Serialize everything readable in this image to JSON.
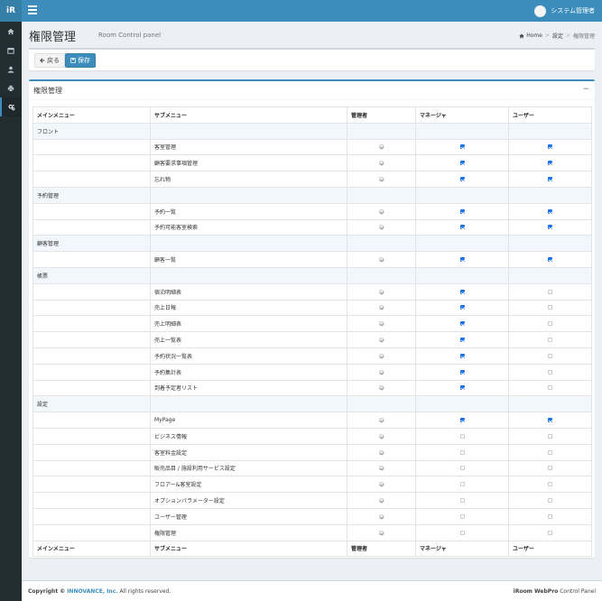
{
  "app": {
    "logo": "iR",
    "user_name": "システム管理者"
  },
  "sidebar": {
    "icons": [
      "home-icon",
      "calendar-icon",
      "user-icon",
      "printer-icon",
      "gears-icon"
    ]
  },
  "header": {
    "title": "権限管理",
    "subtitle": "Room Control panel",
    "breadcrumb": {
      "home": "Home",
      "settings": "設定",
      "current": "権限管理"
    }
  },
  "actions": {
    "back_label": "戻る",
    "save_label": "保存"
  },
  "box": {
    "title": "権限管理",
    "collapse": "−"
  },
  "table": {
    "headers": [
      "メインメニュー",
      "サブメニュー",
      "管理者",
      "マネージャ",
      "ユーザー"
    ],
    "rows": [
      {
        "main": "フロント",
        "section": true
      },
      {
        "sub": "客室管理",
        "admin": true,
        "manager": true,
        "user": true
      },
      {
        "sub": "顧客要求事項管理",
        "admin": true,
        "manager": true,
        "user": true
      },
      {
        "sub": "忘れ物",
        "admin": true,
        "manager": true,
        "user": true
      },
      {
        "main": "予約管理",
        "section": true
      },
      {
        "sub": "予約一覧",
        "admin": true,
        "manager": true,
        "user": true
      },
      {
        "sub": "予約可能客室検索",
        "admin": true,
        "manager": true,
        "user": true
      },
      {
        "main": "顧客管理",
        "section": true
      },
      {
        "sub": "顧客一覧",
        "admin": true,
        "manager": true,
        "user": true
      },
      {
        "main": "帳票",
        "section": true
      },
      {
        "sub": "宿泊明細表",
        "admin": true,
        "manager": true,
        "user": false
      },
      {
        "sub": "売上日報",
        "admin": true,
        "manager": true,
        "user": false
      },
      {
        "sub": "売上明細表",
        "admin": true,
        "manager": true,
        "user": false
      },
      {
        "sub": "売上一覧表",
        "admin": true,
        "manager": true,
        "user": false
      },
      {
        "sub": "予約状況一覧表",
        "admin": true,
        "manager": true,
        "user": false
      },
      {
        "sub": "予約集計表",
        "admin": true,
        "manager": true,
        "user": false
      },
      {
        "sub": "到着予定者リスト",
        "admin": true,
        "manager": true,
        "user": false
      },
      {
        "main": "設定",
        "section": true
      },
      {
        "sub": "MyPage",
        "admin": true,
        "manager": true,
        "user": true
      },
      {
        "sub": "ビジネス情報",
        "admin": true,
        "manager": false,
        "user": false
      },
      {
        "sub": "客室料金設定",
        "admin": true,
        "manager": false,
        "user": false
      },
      {
        "sub": "販売品目 / 施設利用サービス設定",
        "admin": true,
        "manager": false,
        "user": false
      },
      {
        "sub": "フロアー&客室設定",
        "admin": true,
        "manager": false,
        "user": false
      },
      {
        "sub": "オプションパラメーター設定",
        "admin": true,
        "manager": false,
        "user": false
      },
      {
        "sub": "ユーザー管理",
        "admin": true,
        "manager": false,
        "user": false
      },
      {
        "sub": "権限管理",
        "admin": true,
        "manager": false,
        "user": false
      }
    ]
  },
  "footer": {
    "copyright_prefix": "Copyright ©",
    "company": "INNOVANCE, Inc.",
    "rights": "All rights reserved.",
    "product": "iRoom WebPro",
    "product_suffix": "Control Panel"
  }
}
